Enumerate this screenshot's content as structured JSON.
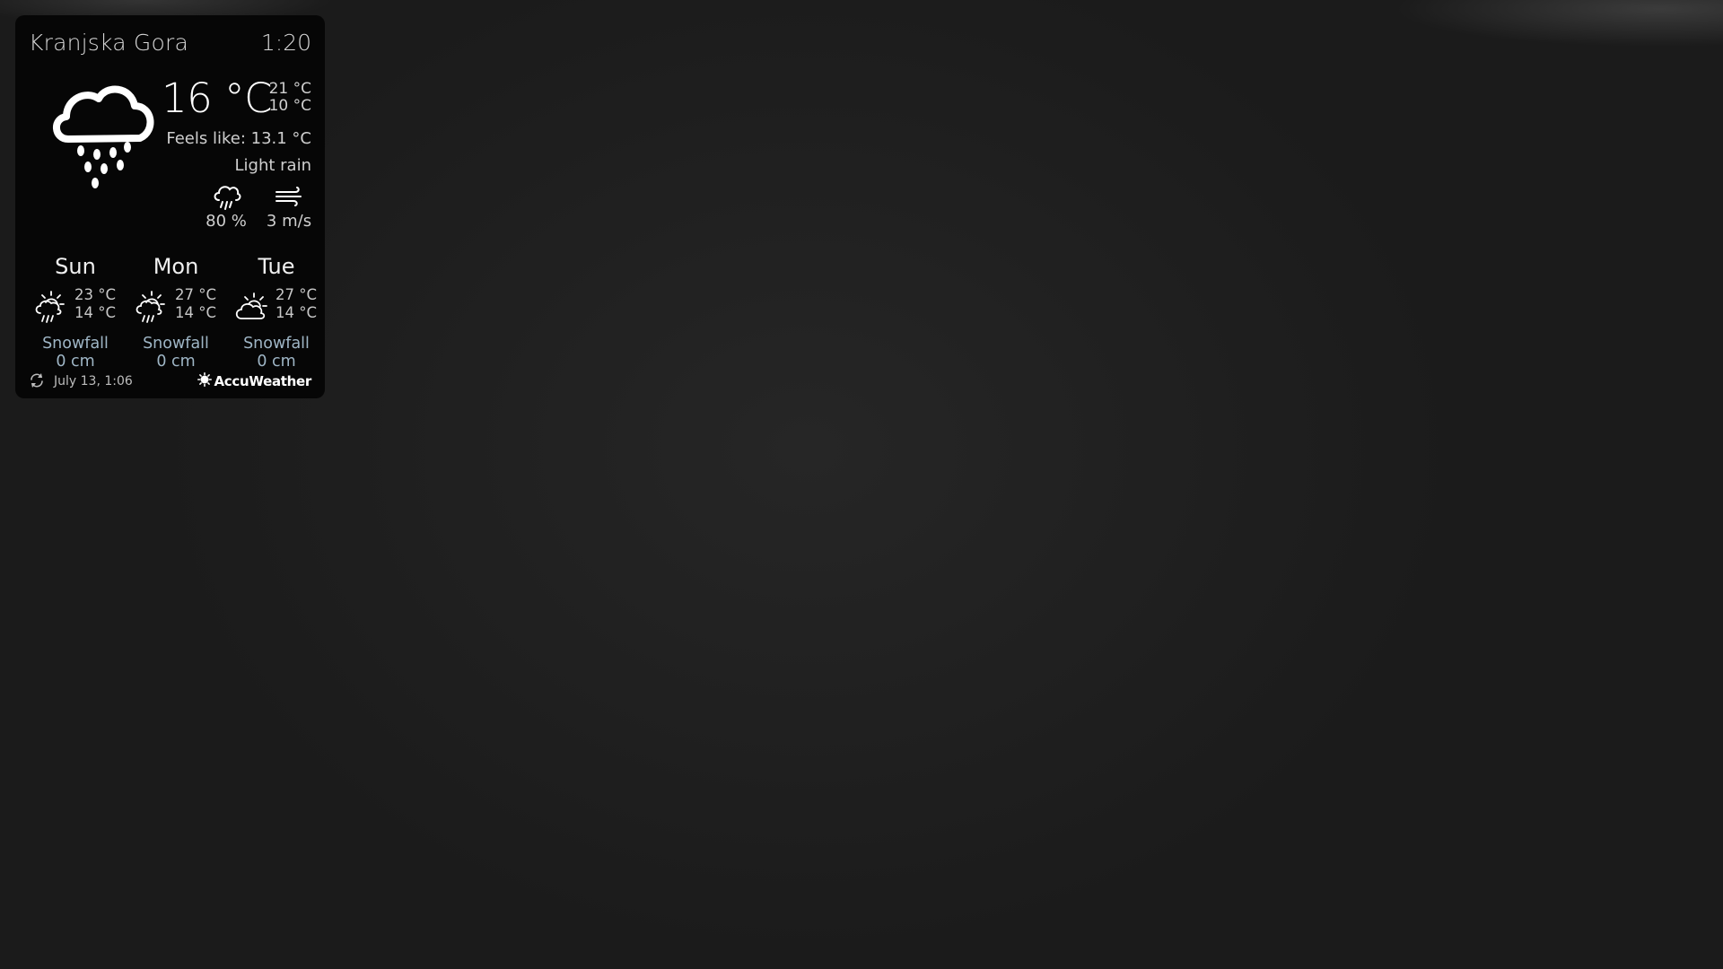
{
  "location": {
    "city": "Kranjska Gora",
    "time": "1:20"
  },
  "current": {
    "icon": "cloud-rain-icon",
    "temperature": "16 °C",
    "high": "21 °C",
    "low": "10 °C",
    "feels_like": "Feels like: 13.1 °C",
    "condition": "Light rain",
    "precipitation": {
      "icon": "rain-icon",
      "value": "80 %"
    },
    "wind": {
      "icon": "wind-icon",
      "value": "3 m/s"
    }
  },
  "forecast": [
    {
      "day": "Sun",
      "icon": "sun-rain-icon",
      "high": "23 °C",
      "low": "14 °C",
      "snow_label": "Snowfall",
      "snow_value": "0 cm"
    },
    {
      "day": "Mon",
      "icon": "sun-rain-icon",
      "high": "27 °C",
      "low": "14 °C",
      "snow_label": "Snowfall",
      "snow_value": "0 cm"
    },
    {
      "day": "Tue",
      "icon": "partly-cloudy-icon",
      "high": "27 °C",
      "low": "14 °C",
      "snow_label": "Snowfall",
      "snow_value": "0 cm"
    }
  ],
  "footer": {
    "updated": "July 13, 1:06",
    "provider": "AccuWeather"
  },
  "colors": {
    "panel": "#040404",
    "text": "#ffffff",
    "muted": "#cfcfcf",
    "snow": "#9fb6c6",
    "background": "#1f1f1f"
  }
}
